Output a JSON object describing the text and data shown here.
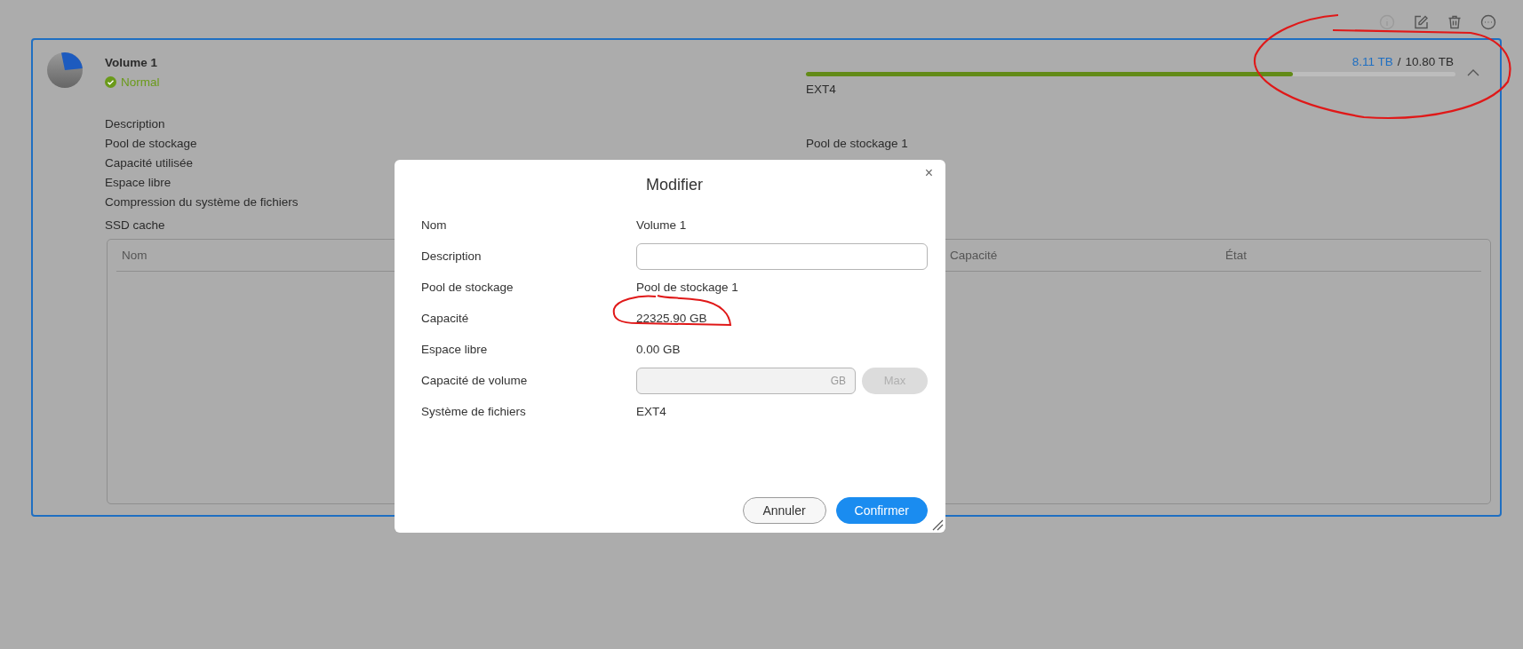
{
  "toolbar_buttons": [
    {
      "kind": "info",
      "disabled": true
    },
    {
      "kind": "edit",
      "disabled": false
    },
    {
      "kind": "delete",
      "disabled": false
    },
    {
      "kind": "more",
      "disabled": false
    }
  ],
  "volume": {
    "name": "Volume 1",
    "status": "Normal",
    "used": "8.11 TB",
    "separator": "/",
    "total": "10.80 TB",
    "level": 0.75,
    "filesystem": "EXT4",
    "expanded": true
  },
  "details": [
    {
      "label": "Description"
    },
    {
      "label": "Pool de stockage",
      "value": "Pool de stockage 1"
    },
    {
      "label": "Capacité utilisée"
    },
    {
      "label": "Espace libre"
    },
    {
      "label": "Compression du système de fichiers"
    }
  ],
  "ssd_cache": {
    "label": "SSD cache",
    "columns": [
      "Nom",
      "Capacité",
      "État"
    ]
  },
  "dialog": {
    "title": "Modifier",
    "close": "×",
    "rows": [
      {
        "kind": "text",
        "label": "Nom",
        "value": "Volume 1"
      },
      {
        "kind": "input",
        "label": "Description",
        "disabled": false
      },
      {
        "kind": "text",
        "label": "Pool de stockage",
        "value": "Pool de stockage 1"
      },
      {
        "kind": "text",
        "label": "Capacité",
        "value": "22325.90 GB"
      },
      {
        "kind": "text",
        "label": "Espace libre",
        "value": "0.00 GB"
      },
      {
        "kind": "unit_input",
        "label": "Capacité de volume",
        "unit": "GB",
        "button": "Max",
        "disabled": true
      },
      {
        "kind": "text",
        "label": "Système de fichiers",
        "value": "EXT4"
      }
    ],
    "buttons": [
      {
        "label": "Annuler",
        "kind": "secondary"
      },
      {
        "label": "Confirmer",
        "kind": "primary"
      }
    ]
  }
}
